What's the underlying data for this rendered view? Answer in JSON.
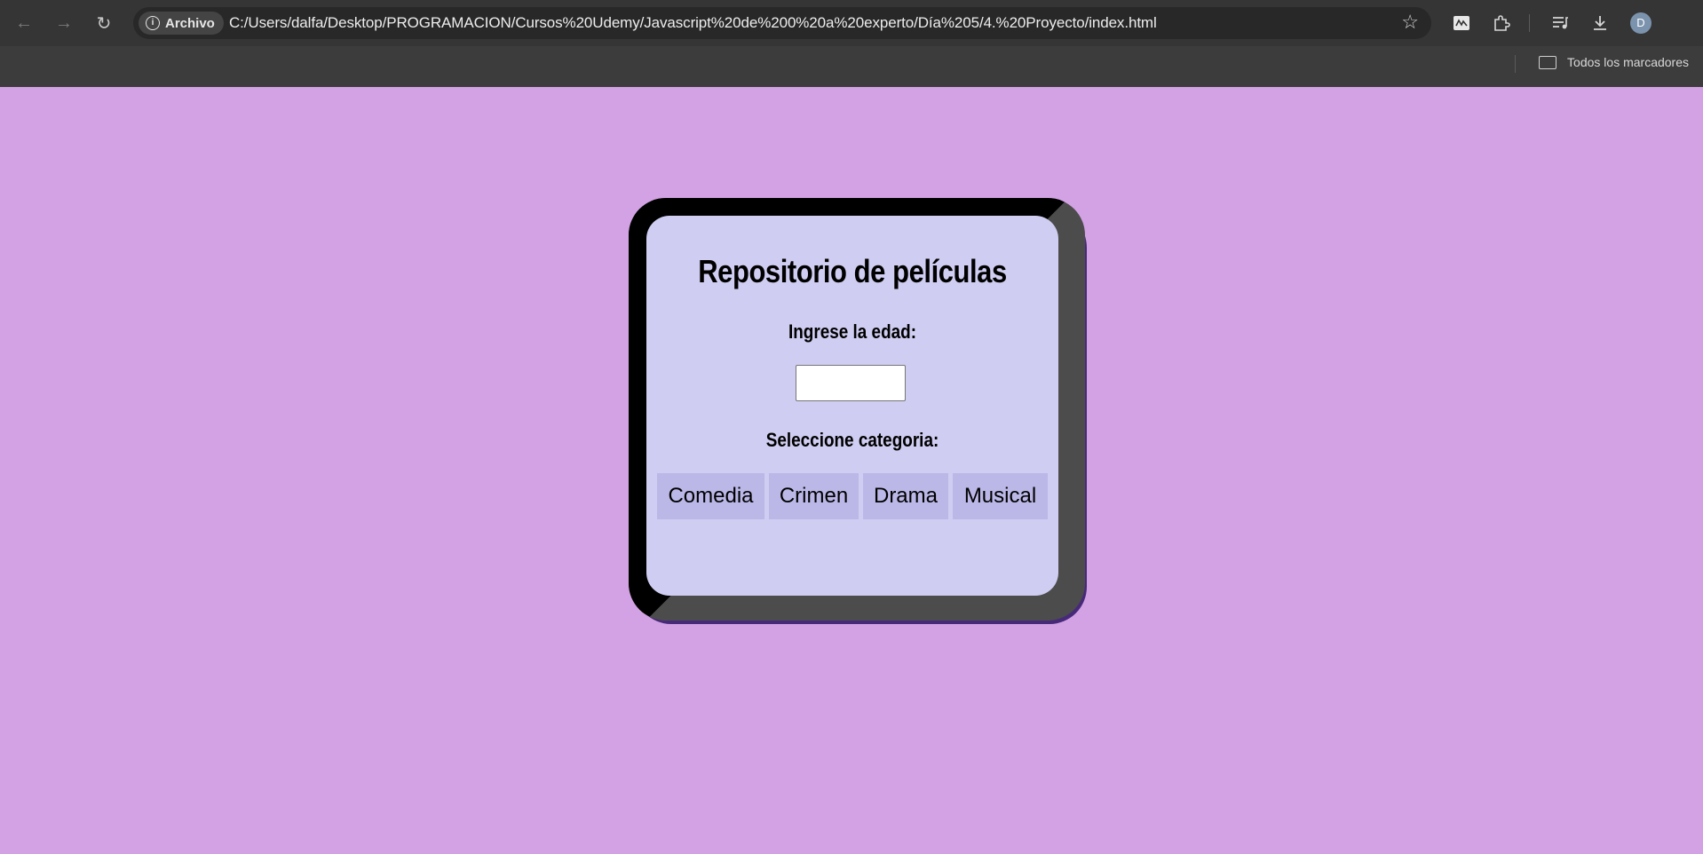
{
  "browser": {
    "security_chip": "Archivo",
    "url": "C:/Users/dalfa/Desktop/PROGRAMACION/Cursos%20Udemy/Javascript%20de%200%20a%20experto/Día%205/4.%20Proyecto/index.html",
    "profile_initial": "D",
    "bookmarks_folder_label": "Todos los marcadores",
    "icons": [
      "back-icon",
      "forward-icon",
      "reload-icon",
      "info-icon",
      "star-icon",
      "extension-icon",
      "puzzle-icon",
      "media-icon",
      "download-icon",
      "folder-icon"
    ]
  },
  "page": {
    "background": "#d3a2e4",
    "title": "Repositorio de películas",
    "age_label": "Ingrese la edad:",
    "age_value": "",
    "category_label": "Seleccione categoria:",
    "categories": [
      {
        "label": "Comedia"
      },
      {
        "label": "Crimen"
      },
      {
        "label": "Drama"
      },
      {
        "label": "Musical"
      }
    ]
  }
}
